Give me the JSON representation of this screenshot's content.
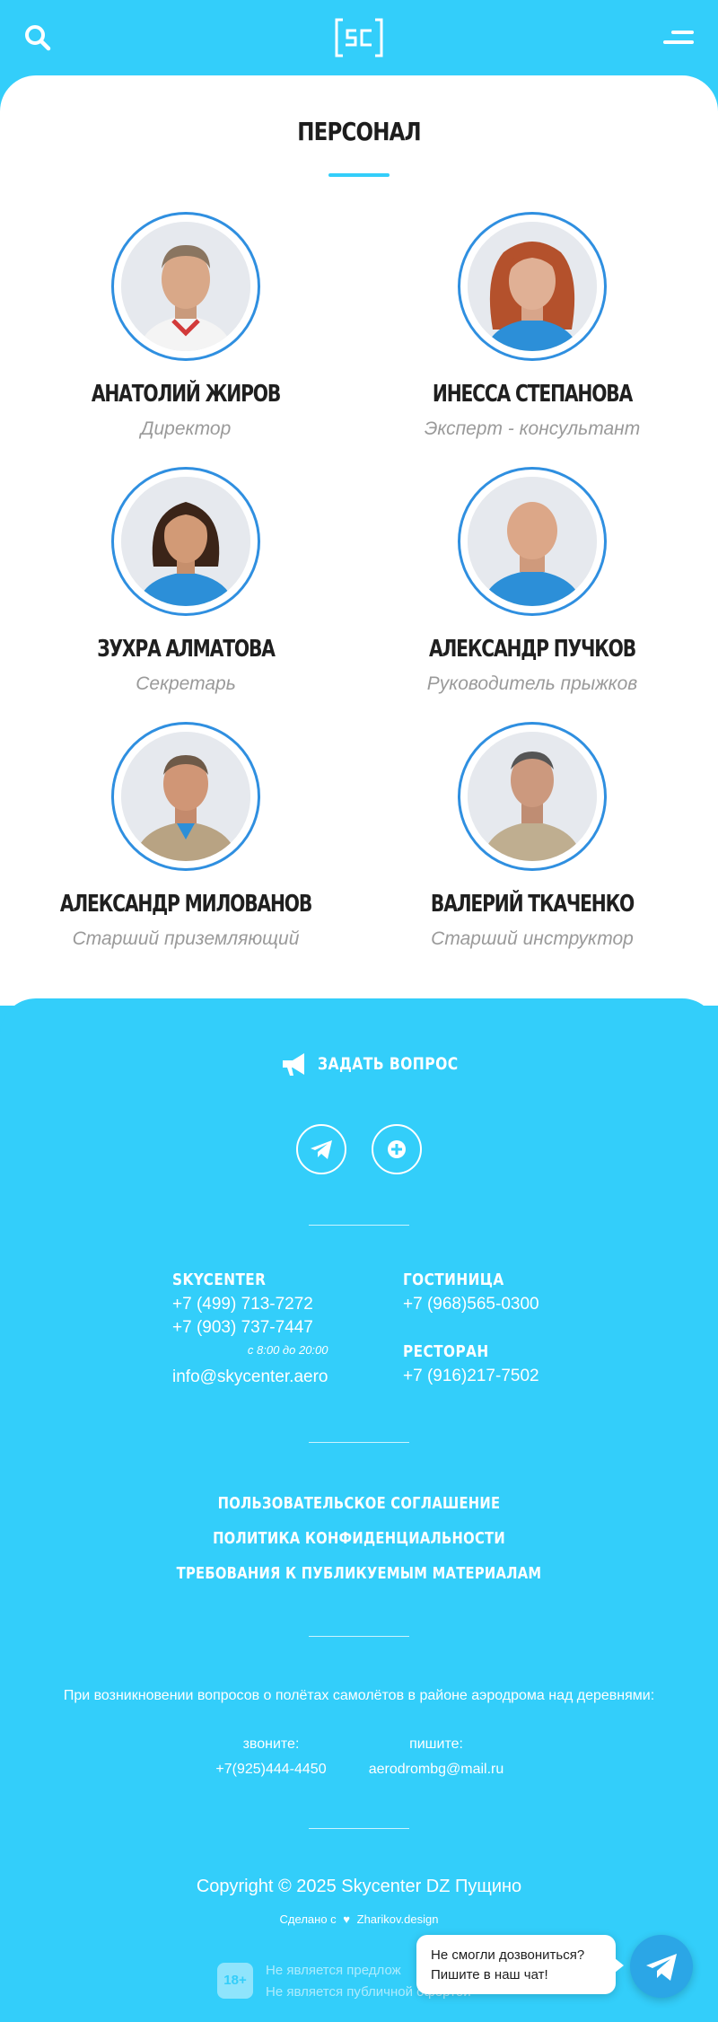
{
  "colors": {
    "brand": "#33cefa",
    "avatar_ring": "#2f8fe0",
    "role_text": "#9a9a9a",
    "chat_button": "#2ba6e6"
  },
  "header": {
    "logo_text": "SC",
    "search_icon": "search-icon",
    "menu_icon": "menu-icon"
  },
  "staff": {
    "title": "ПЕРСОНАЛ",
    "people": [
      {
        "name": "АНАТОЛИЙ ЖИРОВ",
        "role": "Директор"
      },
      {
        "name": "ИНЕССА СТЕПАНОВА",
        "role": "Эксперт - консультант"
      },
      {
        "name": "ЗУХРА АЛМАТОВА",
        "role": "Секретарь"
      },
      {
        "name": "АЛЕКСАНДР ПУЧКОВ",
        "role": "Руководитель прыжков"
      },
      {
        "name": "АЛЕКСАНДР МИЛОВАНОВ",
        "role": "Старший приземляющий"
      },
      {
        "name": "ВАЛЕРИЙ ТКАЧЕНКО",
        "role": "Старший инструктор"
      }
    ]
  },
  "footer": {
    "ask_label": "ЗАДАТЬ ВОПРОС",
    "social": [
      "telegram-icon",
      "add-icon"
    ],
    "skycenter": {
      "heading": "SKYCENTER",
      "phone1": "+7 (499) 713-7272",
      "phone2": "+7 (903) 737-7447",
      "hours": "с 8:00 до 20:00",
      "email": "info@skycenter.aero"
    },
    "hotel": {
      "heading": "ГОСТИНИЦА",
      "phone": "+7 (968)565-0300"
    },
    "restaurant": {
      "heading": "РЕСТОРАН",
      "phone": "+7 (916)217-7502"
    },
    "links": [
      "ПОЛЬЗОВАТЕЛЬСКОЕ СОГЛАШЕНИЕ",
      "ПОЛИТИКА КОНФИДЕНЦИАЛЬНОСТИ",
      "ТРЕБОВАНИЯ К ПУБЛИКУЕМЫМ МАТЕРИАЛАМ"
    ],
    "notice": "При возникновении вопросов о полётах самолётов в районе аэродрома над деревнями:",
    "call_label": "звоните:",
    "call_value": "+7(925)444-4450",
    "write_label": "пишите:",
    "write_value": "aerodrombg@mail.ru",
    "copyright": "Copyright © 2025 Skycenter DZ Пущино",
    "made_prefix": "Сделано с",
    "made_by": "Zharikov.design",
    "age_badge": "18+",
    "offer_line1": "Не является предлож",
    "offer_line2": "Не является публичной офертой"
  },
  "chat": {
    "line1": "Не смогли дозвониться?",
    "line2": "Пишите в наш чат!"
  }
}
